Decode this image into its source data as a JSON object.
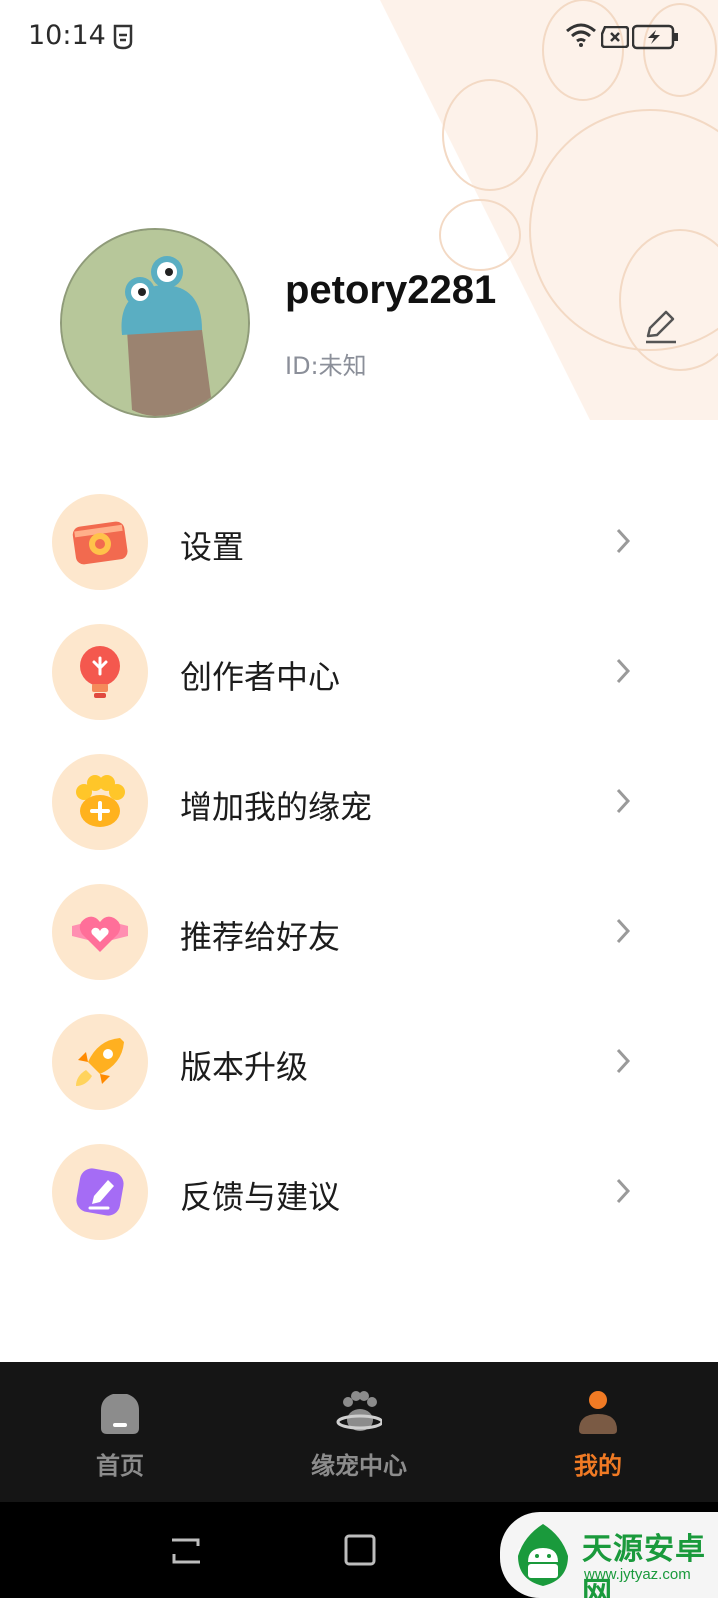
{
  "status_bar": {
    "time": "10:14",
    "left_icon": "status-app-icon",
    "icons": [
      "wifi-icon",
      "sim-icon",
      "battery-charging-icon"
    ]
  },
  "profile": {
    "username": "petory2281",
    "id_text": "ID:未知",
    "avatar": "avatar-cartoon-creature",
    "edit_icon": "edit-icon"
  },
  "menu": {
    "items": [
      {
        "label": "设置",
        "icon": "settings-icon"
      },
      {
        "label": "创作者中心",
        "icon": "creator-center-icon"
      },
      {
        "label": "增加我的缘宠",
        "icon": "add-pet-paw-icon"
      },
      {
        "label": "推荐给好友",
        "icon": "recommend-heart-icon"
      },
      {
        "label": "版本升级",
        "icon": "rocket-upgrade-icon"
      },
      {
        "label": "反馈与建议",
        "icon": "feedback-pen-icon"
      }
    ]
  },
  "tab_bar": {
    "tabs": [
      {
        "label": "首页",
        "icon": "home-icon",
        "active": false
      },
      {
        "label": "缘宠中心",
        "icon": "paw-planet-icon",
        "active": false
      },
      {
        "label": "我的",
        "icon": "profile-person-icon",
        "active": true
      }
    ],
    "colors": {
      "active": "#f07a24",
      "inactive": "#8c8c8c",
      "background": "#151515"
    }
  },
  "nav_bar": {
    "icons": [
      "recent-apps-icon",
      "home-square-icon",
      "back-icon"
    ]
  },
  "watermark": {
    "title": "天源安卓网",
    "url": "www.jytyaz.com"
  },
  "colors": {
    "accent": "#f07a24",
    "icon_circle": "#fde7cd"
  }
}
